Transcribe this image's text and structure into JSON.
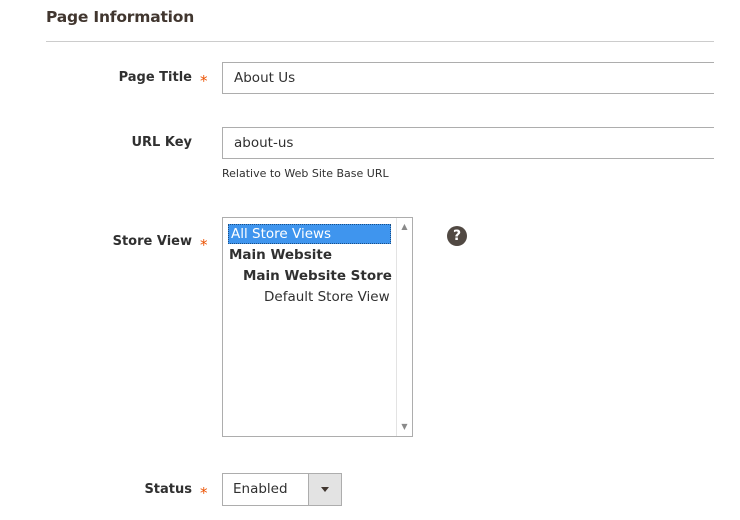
{
  "section": {
    "title": "Page Information"
  },
  "fields": {
    "page_title": {
      "label": "Page Title",
      "required_mark": "*",
      "value": "About Us"
    },
    "url_key": {
      "label": "URL Key",
      "value": "about-us",
      "note": "Relative to Web Site Base URL"
    },
    "store_view": {
      "label": "Store View",
      "required_mark": "*",
      "options": [
        {
          "label": "All Store Views",
          "selected": true
        },
        {
          "label": "Main Website",
          "selected": false
        },
        {
          "label": "Main Website Store",
          "selected": false
        },
        {
          "label": "Default Store View",
          "selected": false
        }
      ],
      "help_icon": "question-circle-icon",
      "help_glyph": "?",
      "scroll_up_glyph": "▲",
      "scroll_down_glyph": "▼"
    },
    "status": {
      "label": "Status",
      "required_mark": "*",
      "value": "Enabled"
    }
  },
  "colors": {
    "required": "#eb5202",
    "selection": "#3f95ee",
    "help_icon_bg": "#514943"
  }
}
